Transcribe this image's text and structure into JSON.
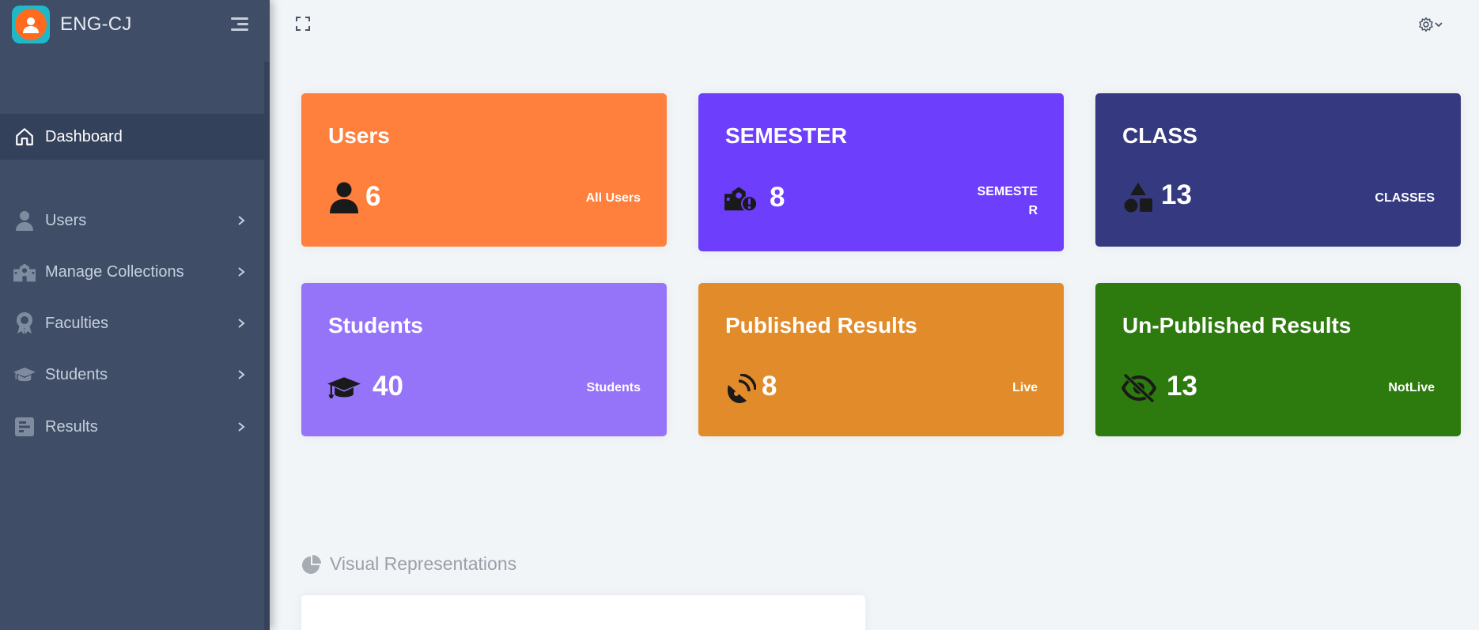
{
  "app": {
    "title": "ENG-CJ"
  },
  "sidebar": {
    "items": [
      {
        "label": "Dashboard",
        "icon": "home-icon",
        "active": true
      },
      {
        "label": "Users",
        "icon": "user-icon",
        "has_submenu": true
      },
      {
        "label": "Manage Collections",
        "icon": "school-icon",
        "has_submenu": true
      },
      {
        "label": "Faculties",
        "icon": "award-icon",
        "has_submenu": true
      },
      {
        "label": "Students",
        "icon": "graduation-cap-icon",
        "has_submenu": true
      },
      {
        "label": "Results",
        "icon": "poll-icon",
        "has_submenu": true
      }
    ]
  },
  "topbar": {
    "expand_icon": "expand-icon",
    "settings_icon": "gear-icon"
  },
  "cards": [
    {
      "title": "Users",
      "count": "6",
      "caption": "All Users",
      "icon": "user-icon",
      "color": "#ff803d"
    },
    {
      "title": "SEMESTER",
      "count": "8",
      "caption_line1": "SEMESTE",
      "caption_line2": "R",
      "icon": "school-alert-icon",
      "color": "#6d3ffd"
    },
    {
      "title": "CLASS",
      "count": "13",
      "caption": "CLASSES",
      "icon": "shapes-icon",
      "color": "#353a80"
    },
    {
      "title": "Students",
      "count": "40",
      "caption": "Students",
      "icon": "graduation-cap-icon",
      "color": "#9674fa"
    },
    {
      "title": "Published Results",
      "count": "8",
      "caption": "Live",
      "icon": "satellite-dish-icon",
      "color": "#e28b2a"
    },
    {
      "title": "Un-Published Results",
      "count": "13",
      "caption": "NotLive",
      "icon": "eye-slash-icon",
      "color": "#2d7b0e"
    }
  ],
  "section": {
    "title": "Visual Representations",
    "icon": "pie-chart-icon"
  }
}
